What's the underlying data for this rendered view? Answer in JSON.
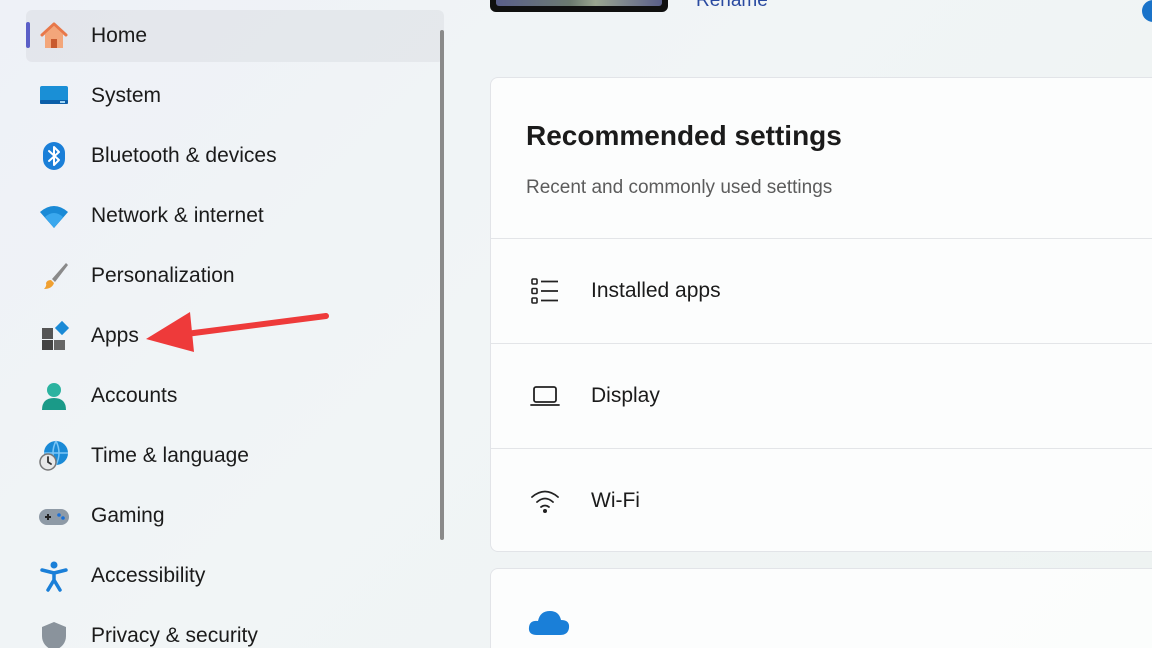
{
  "sidebar": {
    "items": [
      {
        "label": "Home",
        "icon": "home-icon",
        "selected": true
      },
      {
        "label": "System",
        "icon": "system-icon"
      },
      {
        "label": "Bluetooth & devices",
        "icon": "bluetooth-icon"
      },
      {
        "label": "Network & internet",
        "icon": "wifi-network-icon"
      },
      {
        "label": "Personalization",
        "icon": "paintbrush-icon"
      },
      {
        "label": "Apps",
        "icon": "apps-icon"
      },
      {
        "label": "Accounts",
        "icon": "account-icon"
      },
      {
        "label": "Time & language",
        "icon": "globe-clock-icon"
      },
      {
        "label": "Gaming",
        "icon": "gamepad-icon"
      },
      {
        "label": "Accessibility",
        "icon": "accessibility-icon"
      },
      {
        "label": "Privacy & security",
        "icon": "shield-icon"
      }
    ],
    "accent": "#5b5fc7"
  },
  "header": {
    "rename_label": "Rename"
  },
  "recommended": {
    "title": "Recommended settings",
    "subtitle": "Recent and commonly used settings",
    "rows": [
      {
        "label": "Installed apps",
        "icon": "list-icon"
      },
      {
        "label": "Display",
        "icon": "laptop-icon"
      },
      {
        "label": "Wi-Fi",
        "icon": "wifi-icon"
      }
    ]
  },
  "next_card": {
    "icon": "onedrive-cloud-icon"
  },
  "annotation": {
    "type": "arrow",
    "color": "#ee3a3a",
    "points_to": "Apps"
  }
}
